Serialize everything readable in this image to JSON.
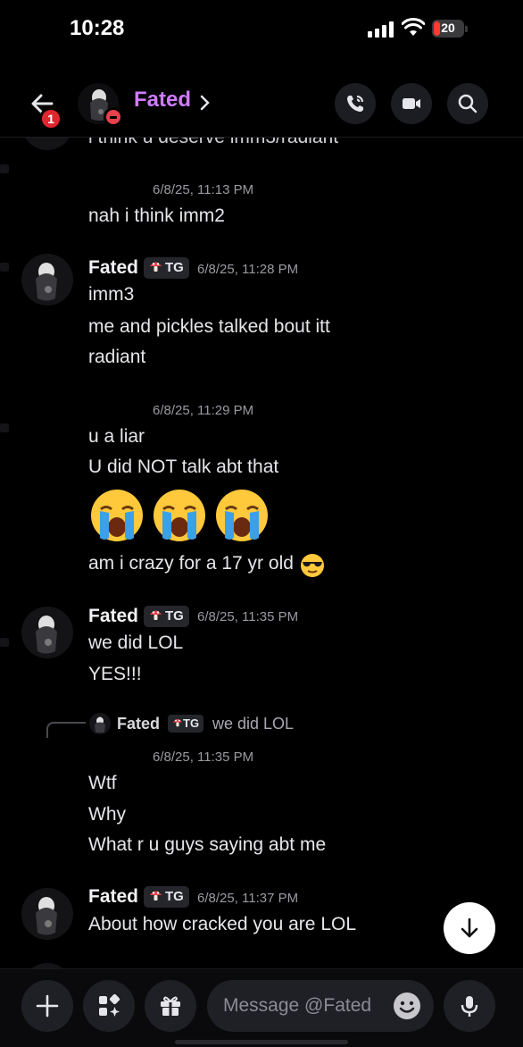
{
  "status_bar": {
    "time": "10:28",
    "battery": "20"
  },
  "header": {
    "name": "Fated",
    "notification_count": "1",
    "name_color": "#cf7bff"
  },
  "messages": {
    "partial_top": "i think u deserve imm3/radiant",
    "ts1": "6/8/25, 11:13 PM",
    "m1": "nah i think imm2",
    "g1": {
      "author": "Fated",
      "tag": "TG",
      "ts": "6/8/25, 11:28 PM",
      "lines": [
        "imm3",
        "me and pickles talked bout itt",
        "radiant"
      ]
    },
    "ts2": "6/8/25, 11:29 PM",
    "m2": [
      "u a liar",
      "U did NOT talk abt that",
      "am i crazy for a 17 yr old"
    ],
    "emojis": [
      "loudly-crying-face",
      "loudly-crying-face",
      "loudly-crying-face"
    ],
    "inline_emoji": "smiling-face-with-sunglasses",
    "g2": {
      "author": "Fated",
      "tag": "TG",
      "ts": "6/8/25, 11:35 PM",
      "lines": [
        "we did LOL",
        "YES!!!"
      ]
    },
    "reply": {
      "author": "Fated",
      "tag": "TG",
      "text": "we did LOL"
    },
    "ts3": "6/8/25, 11:35 PM",
    "m3": [
      "Wtf",
      "Why",
      "What r u guys saying abt me"
    ],
    "g3": {
      "author": "Fated",
      "tag": "TG",
      "ts": "6/8/25, 11:37 PM",
      "lines": [
        "About how cracked you are LOL"
      ]
    }
  },
  "composer": {
    "placeholder": "Message @Fated"
  }
}
